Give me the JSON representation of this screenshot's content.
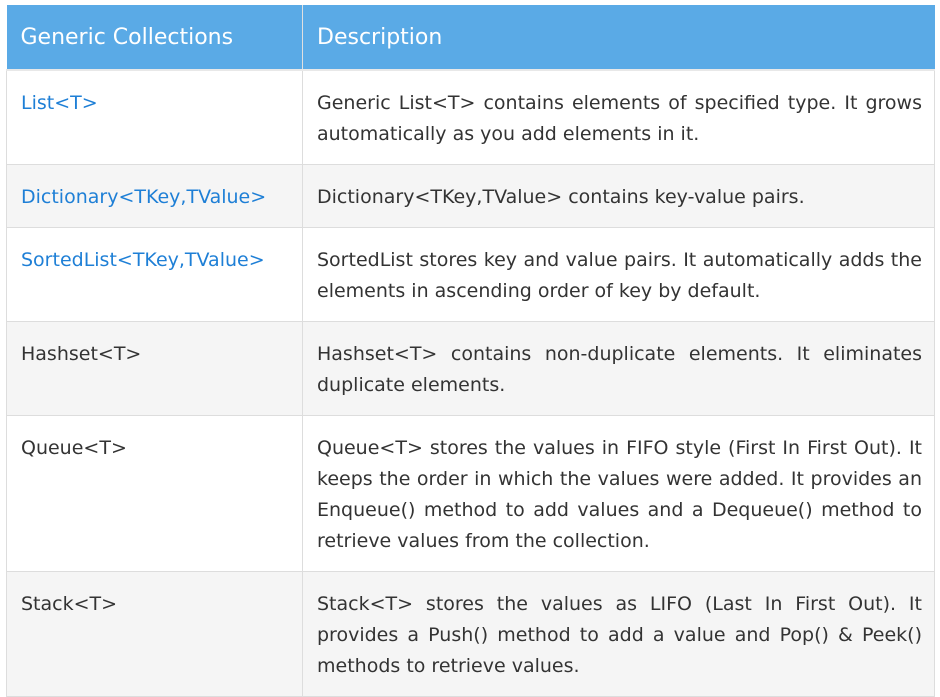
{
  "table": {
    "headers": [
      "Generic Collections",
      "Description"
    ],
    "rows": [
      {
        "name": "List<T>",
        "is_link": true,
        "description": "Generic List<T> contains elements of specified type. It grows automatically as you add elements in it."
      },
      {
        "name": "Dictionary<TKey,TValue>",
        "is_link": true,
        "description": "Dictionary<TKey,TValue> contains key-value pairs."
      },
      {
        "name": "SortedList<TKey,TValue>",
        "is_link": true,
        "description": "SortedList stores key and value pairs. It automatically adds the elements in ascending order of key by default."
      },
      {
        "name": "Hashset<T>",
        "is_link": false,
        "description": "Hashset<T> contains non-duplicate elements. It eliminates duplicate elements."
      },
      {
        "name": "Queue<T>",
        "is_link": false,
        "description": "Queue<T> stores the values in FIFO style (First In First Out). It keeps the order in which the values were added. It provides an Enqueue() method to add values and a Dequeue() method to retrieve values from the collection."
      },
      {
        "name": "Stack<T>",
        "is_link": false,
        "description": "Stack<T> stores the values as LIFO (Last In First Out). It provides a Push() method to add a value and Pop() & Peek() methods to retrieve values."
      }
    ]
  },
  "colors": {
    "header_bg": "#5aaae6",
    "header_text": "#ffffff",
    "link": "#1e7fd6",
    "text": "#333333",
    "row_alt": "#f5f5f5",
    "border": "#dddddd"
  }
}
